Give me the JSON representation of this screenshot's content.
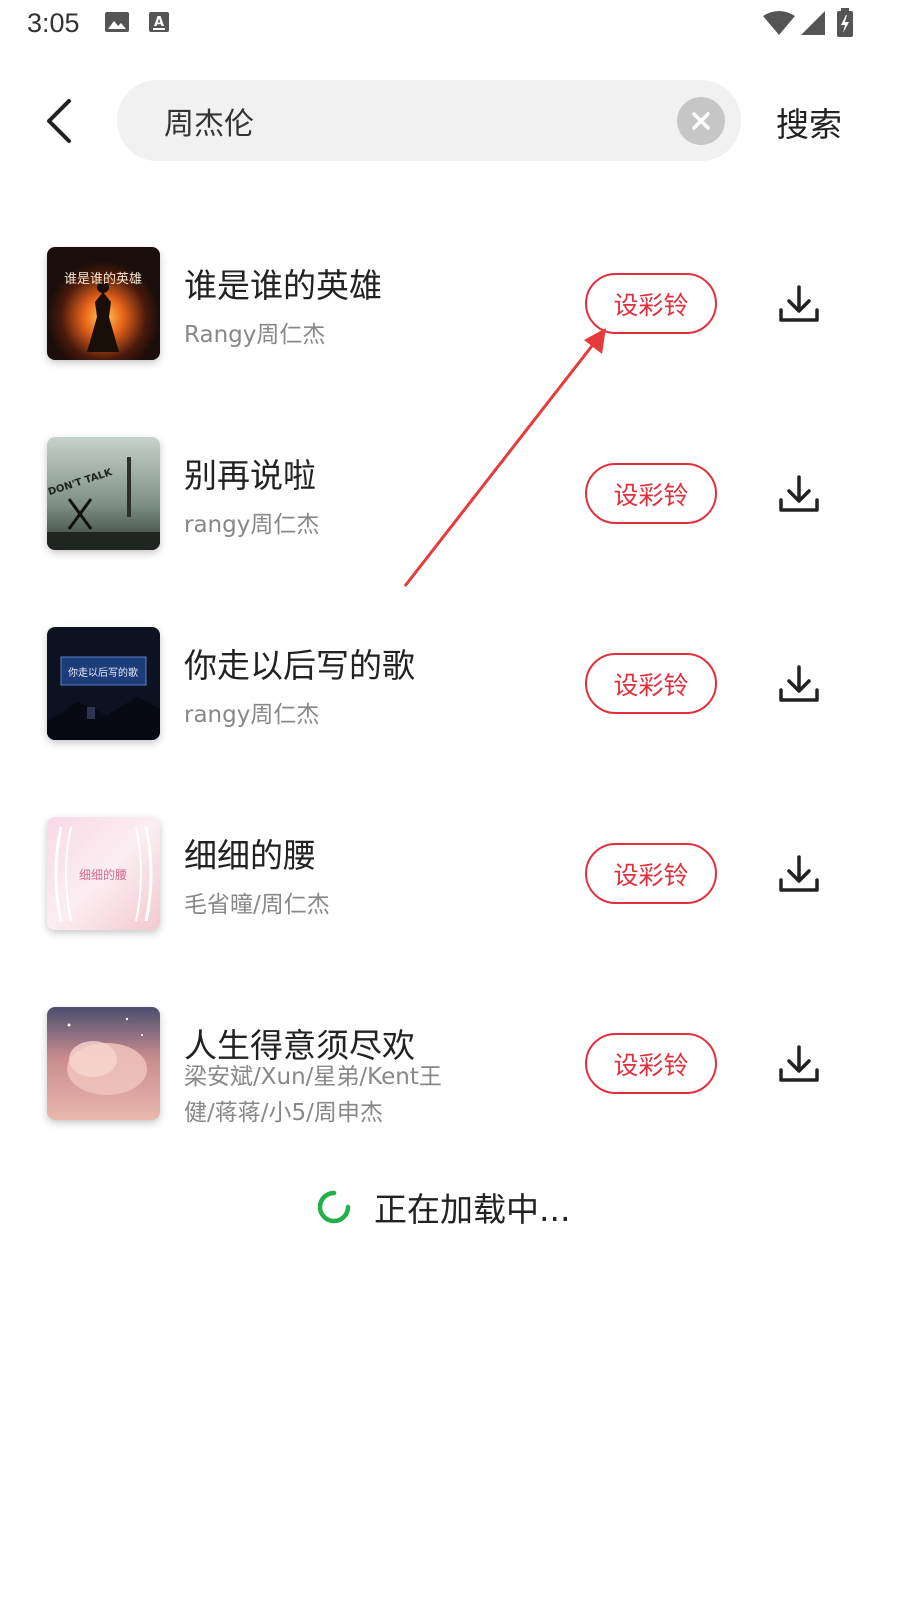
{
  "status_bar": {
    "time": "3:05",
    "icons": [
      "image-icon",
      "a-icon",
      "wifi-icon",
      "cell-signal-icon",
      "battery-charging-icon"
    ]
  },
  "search": {
    "query": "周杰伦",
    "placeholder": "",
    "action_label": "搜索"
  },
  "colors": {
    "accent": "#e0303e",
    "spinner": "#22b04a",
    "annotation_arrow": "#e53b3b"
  },
  "songs": [
    {
      "title": "谁是谁的英雄",
      "artist": "Rangy周仁杰",
      "ring_label": "设彩铃",
      "cover_text": "谁是谁的英雄"
    },
    {
      "title": "别再说啦",
      "artist": "rangy周仁杰",
      "ring_label": "设彩铃",
      "cover_text": "DON'T TALK"
    },
    {
      "title": "你走以后写的歌",
      "artist": "rangy周仁杰",
      "ring_label": "设彩铃",
      "cover_text": "你走以后写的歌"
    },
    {
      "title": "细细的腰",
      "artist": "毛省曈/周仁杰",
      "ring_label": "设彩铃",
      "cover_text": "细细的腰"
    },
    {
      "title": "人生得意须尽欢",
      "artist": "梁安斌/Xun/星弟/Kent王健/蒋蒋/小5/周申杰",
      "ring_label": "设彩铃",
      "cover_text": ""
    }
  ],
  "loading": {
    "text": "正在加载中..."
  }
}
